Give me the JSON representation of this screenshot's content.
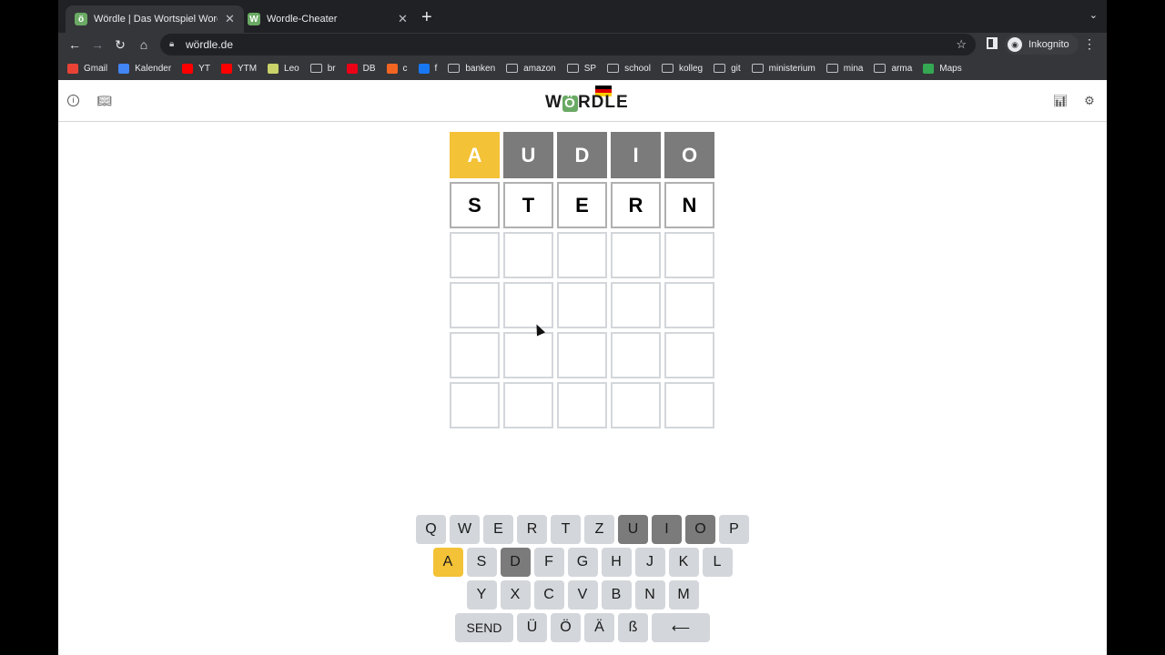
{
  "browser": {
    "tabs": [
      {
        "title": "Wördle | Das Wortspiel Wordle",
        "favicon": "ö",
        "favicon_color": "#6aaa64",
        "active": true
      },
      {
        "title": "Wordle-Cheater",
        "favicon": "W",
        "favicon_color": "#6aaa64",
        "active": false
      }
    ],
    "url": "wördle.de",
    "profile": "Inkognito",
    "bookmarks": [
      {
        "label": "Gmail",
        "icon": "gmail-icon",
        "color": "#ea4335"
      },
      {
        "label": "Kalender",
        "icon": "calendar-icon",
        "color": "#4285f4"
      },
      {
        "label": "YT",
        "icon": "youtube-icon",
        "color": "#ff0000"
      },
      {
        "label": "YTM",
        "icon": "youtube-music-icon",
        "color": "#ff0000"
      },
      {
        "label": "Leo",
        "icon": "leo-icon",
        "color": "#c9d36a"
      },
      {
        "label": "br",
        "icon": "folder-icon",
        "color": ""
      },
      {
        "label": "DB",
        "icon": "db-icon",
        "color": "#ec0016"
      },
      {
        "label": "c",
        "icon": "c-icon",
        "color": "#f26522"
      },
      {
        "label": "f",
        "icon": "facebook-icon",
        "color": "#1877f2"
      },
      {
        "label": "banken",
        "icon": "folder-icon",
        "color": ""
      },
      {
        "label": "amazon",
        "icon": "folder-icon",
        "color": ""
      },
      {
        "label": "SP",
        "icon": "folder-icon",
        "color": ""
      },
      {
        "label": "school",
        "icon": "folder-icon",
        "color": ""
      },
      {
        "label": "kolleg",
        "icon": "folder-icon",
        "color": ""
      },
      {
        "label": "git",
        "icon": "folder-icon",
        "color": ""
      },
      {
        "label": "ministerium",
        "icon": "folder-icon",
        "color": ""
      },
      {
        "label": "mina",
        "icon": "folder-icon",
        "color": ""
      },
      {
        "label": "arma",
        "icon": "folder-icon",
        "color": ""
      },
      {
        "label": "Maps",
        "icon": "maps-icon",
        "color": "#34a853"
      }
    ]
  },
  "game": {
    "logo_text": "WÖRDLE",
    "colors": {
      "present": "#f3c237",
      "absent": "#7b7b7b",
      "empty_border": "#d3d6da"
    },
    "rows": [
      [
        {
          "l": "A",
          "s": "present"
        },
        {
          "l": "U",
          "s": "absent"
        },
        {
          "l": "D",
          "s": "absent"
        },
        {
          "l": "I",
          "s": "absent"
        },
        {
          "l": "O",
          "s": "absent"
        }
      ],
      [
        {
          "l": "S",
          "s": "filled"
        },
        {
          "l": "T",
          "s": "filled"
        },
        {
          "l": "E",
          "s": "filled"
        },
        {
          "l": "R",
          "s": "filled"
        },
        {
          "l": "N",
          "s": "filled"
        }
      ],
      [
        {
          "l": "",
          "s": "empty"
        },
        {
          "l": "",
          "s": "empty"
        },
        {
          "l": "",
          "s": "empty"
        },
        {
          "l": "",
          "s": "empty"
        },
        {
          "l": "",
          "s": "empty"
        }
      ],
      [
        {
          "l": "",
          "s": "empty"
        },
        {
          "l": "",
          "s": "empty"
        },
        {
          "l": "",
          "s": "empty"
        },
        {
          "l": "",
          "s": "empty"
        },
        {
          "l": "",
          "s": "empty"
        }
      ],
      [
        {
          "l": "",
          "s": "empty"
        },
        {
          "l": "",
          "s": "empty"
        },
        {
          "l": "",
          "s": "empty"
        },
        {
          "l": "",
          "s": "empty"
        },
        {
          "l": "",
          "s": "empty"
        }
      ],
      [
        {
          "l": "",
          "s": "empty"
        },
        {
          "l": "",
          "s": "empty"
        },
        {
          "l": "",
          "s": "empty"
        },
        {
          "l": "",
          "s": "empty"
        },
        {
          "l": "",
          "s": "empty"
        }
      ]
    ],
    "keyboard": [
      [
        {
          "k": "Q"
        },
        {
          "k": "W"
        },
        {
          "k": "E"
        },
        {
          "k": "R"
        },
        {
          "k": "T"
        },
        {
          "k": "Z"
        },
        {
          "k": "U",
          "s": "absent"
        },
        {
          "k": "I",
          "s": "absent"
        },
        {
          "k": "O",
          "s": "absent"
        },
        {
          "k": "P"
        }
      ],
      [
        {
          "k": "A",
          "s": "present"
        },
        {
          "k": "S"
        },
        {
          "k": "D",
          "s": "absent"
        },
        {
          "k": "F"
        },
        {
          "k": "G"
        },
        {
          "k": "H"
        },
        {
          "k": "J"
        },
        {
          "k": "K"
        },
        {
          "k": "L"
        }
      ],
      [
        {
          "k": "Y"
        },
        {
          "k": "X"
        },
        {
          "k": "C"
        },
        {
          "k": "V"
        },
        {
          "k": "B"
        },
        {
          "k": "N"
        },
        {
          "k": "M"
        }
      ],
      [
        {
          "k": "SEND",
          "wide": true
        },
        {
          "k": "Ü"
        },
        {
          "k": "Ö"
        },
        {
          "k": "Ä"
        },
        {
          "k": "ß"
        },
        {
          "k": "⟵",
          "wide": true
        }
      ]
    ]
  }
}
